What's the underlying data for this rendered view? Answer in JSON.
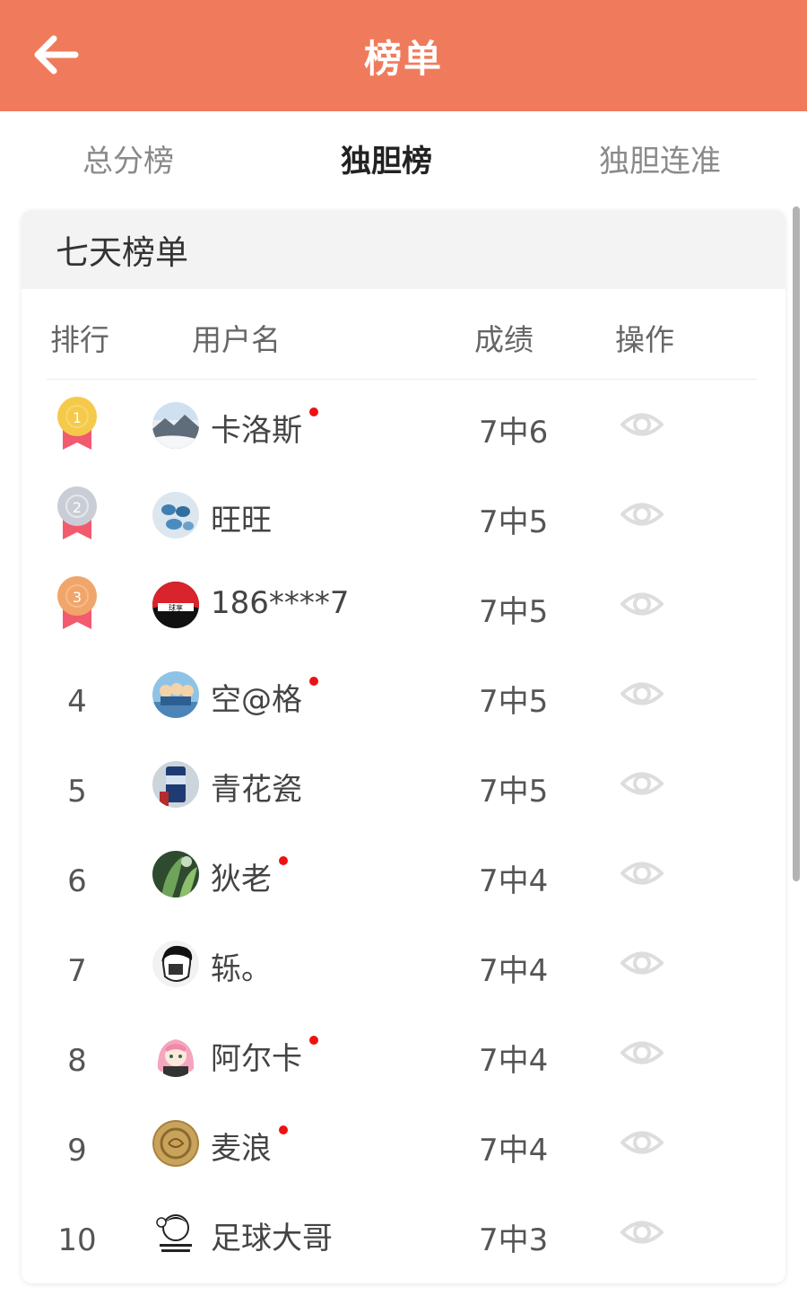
{
  "header": {
    "title": "榜单",
    "back_icon": "arrow-left-icon",
    "color": "#f07b5c"
  },
  "tabs": [
    {
      "label": "总分榜",
      "active": false
    },
    {
      "label": "独胆榜",
      "active": true
    },
    {
      "label": "独胆连准",
      "active": false
    }
  ],
  "card": {
    "title": "七天榜单",
    "columns": {
      "rank": "排行",
      "user": "用户名",
      "score": "成绩",
      "action": "操作"
    },
    "rows": [
      {
        "rank": "1",
        "medal": "gold",
        "name": "卡洛斯",
        "badge": true,
        "score": "7中6",
        "avatar": "snowy-landscape"
      },
      {
        "rank": "2",
        "medal": "silver",
        "name": "旺旺",
        "badge": false,
        "score": "7中5",
        "avatar": "blue-butterflies"
      },
      {
        "rank": "3",
        "medal": "bronze",
        "name": "186****7",
        "badge": false,
        "score": "7中5",
        "avatar": "red-logo"
      },
      {
        "rank": "4",
        "medal": null,
        "name": "空@格",
        "badge": true,
        "score": "7中5",
        "avatar": "cartoon-team"
      },
      {
        "rank": "5",
        "medal": null,
        "name": "青花瓷",
        "badge": false,
        "score": "7中5",
        "avatar": "coffee-cup"
      },
      {
        "rank": "6",
        "medal": null,
        "name": "狄老",
        "badge": true,
        "score": "7中4",
        "avatar": "green-plant"
      },
      {
        "rank": "7",
        "medal": null,
        "name": "轹。",
        "badge": false,
        "score": "7中4",
        "avatar": "portrait-sketch"
      },
      {
        "rank": "8",
        "medal": null,
        "name": "阿尔卡",
        "badge": true,
        "score": "7中4",
        "avatar": "anime-girl"
      },
      {
        "rank": "9",
        "medal": null,
        "name": "麦浪",
        "badge": true,
        "score": "7中4",
        "avatar": "gold-coin"
      },
      {
        "rank": "10",
        "medal": null,
        "name": "足球大哥",
        "badge": false,
        "score": "7中3",
        "avatar": "cartoon-face"
      }
    ]
  },
  "colors": {
    "accent": "#f07b5c",
    "badge": "#ee1111",
    "gold": "#f5c94a",
    "silver": "#c9cdd6",
    "bronze": "#f0a66a",
    "ribbon": "#f25a6e"
  }
}
